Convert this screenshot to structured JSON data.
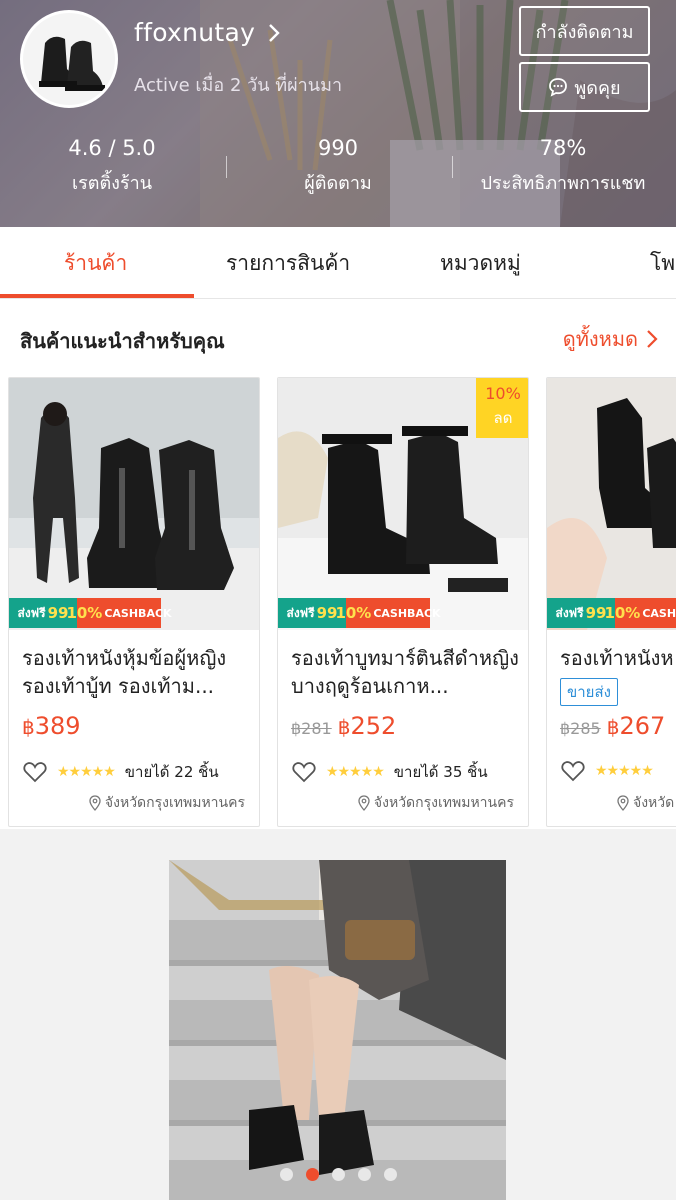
{
  "shop": {
    "name": "ffoxnutay",
    "active_status": "Active เมื่อ 2 วัน ที่ผ่านมา",
    "follow_label": "กำลังติดตาม",
    "chat_label": "พูดคุย"
  },
  "stats": [
    {
      "value": "4.6 / 5.0",
      "label": "เรตติ้งร้าน"
    },
    {
      "value": "990",
      "label": "ผู้ติดตาม"
    },
    {
      "value": "78%",
      "label": "ประสิทธิภาพการแชท"
    }
  ],
  "tabs": [
    {
      "label": "ร้านค้า",
      "active": true
    },
    {
      "label": "รายการสินค้า",
      "active": false
    },
    {
      "label": "หมวดหมู่",
      "active": false
    },
    {
      "label": "โพ",
      "active": false
    }
  ],
  "recommended": {
    "title": "สินค้าแนะนำสำหรับคุณ",
    "see_all": "ดูทั้งหมด"
  },
  "promo": {
    "ship_label": "ส่งฟรี",
    "ship_amount": "99",
    "cashback_pct": "10%",
    "cashback_label": "CASHBACK"
  },
  "products": [
    {
      "name": "รองเท้าหนังหุ้มข้อผู้หญิง รองเท้าบู้ท รองเท้าม...",
      "currency": "฿",
      "price": "389",
      "old_price": "",
      "discount": "",
      "discount_label": "",
      "wholesale": "",
      "sold": "ขายได้ 22 ชิ้น",
      "location": "จังหวัดกรุงเทพมหานคร"
    },
    {
      "name": "รองเท้าบูทมาร์ตินสีดำหญิงบางฤดูร้อนเกาห...",
      "currency": "฿",
      "price": "252",
      "old_price": "฿281",
      "discount": "10%",
      "discount_label": "ลด",
      "wholesale": "",
      "sold": "ขายได้ 35 ชิ้น",
      "location": "จังหวัดกรุงเทพมหานคร"
    },
    {
      "name": "รองเท้าหนังห",
      "currency": "฿",
      "price": "267",
      "old_price": "฿285",
      "discount": "",
      "discount_label": "",
      "wholesale": "ขายส่ง",
      "sold": "",
      "location": "จังหวัด"
    }
  ],
  "banner": {
    "slide_count": 5,
    "active_slide": 2
  },
  "colors": {
    "accent": "#ee4d2d",
    "star": "#ffce3d",
    "wholesale": "#2e8fd8",
    "ship_badge": "#14a38b"
  }
}
